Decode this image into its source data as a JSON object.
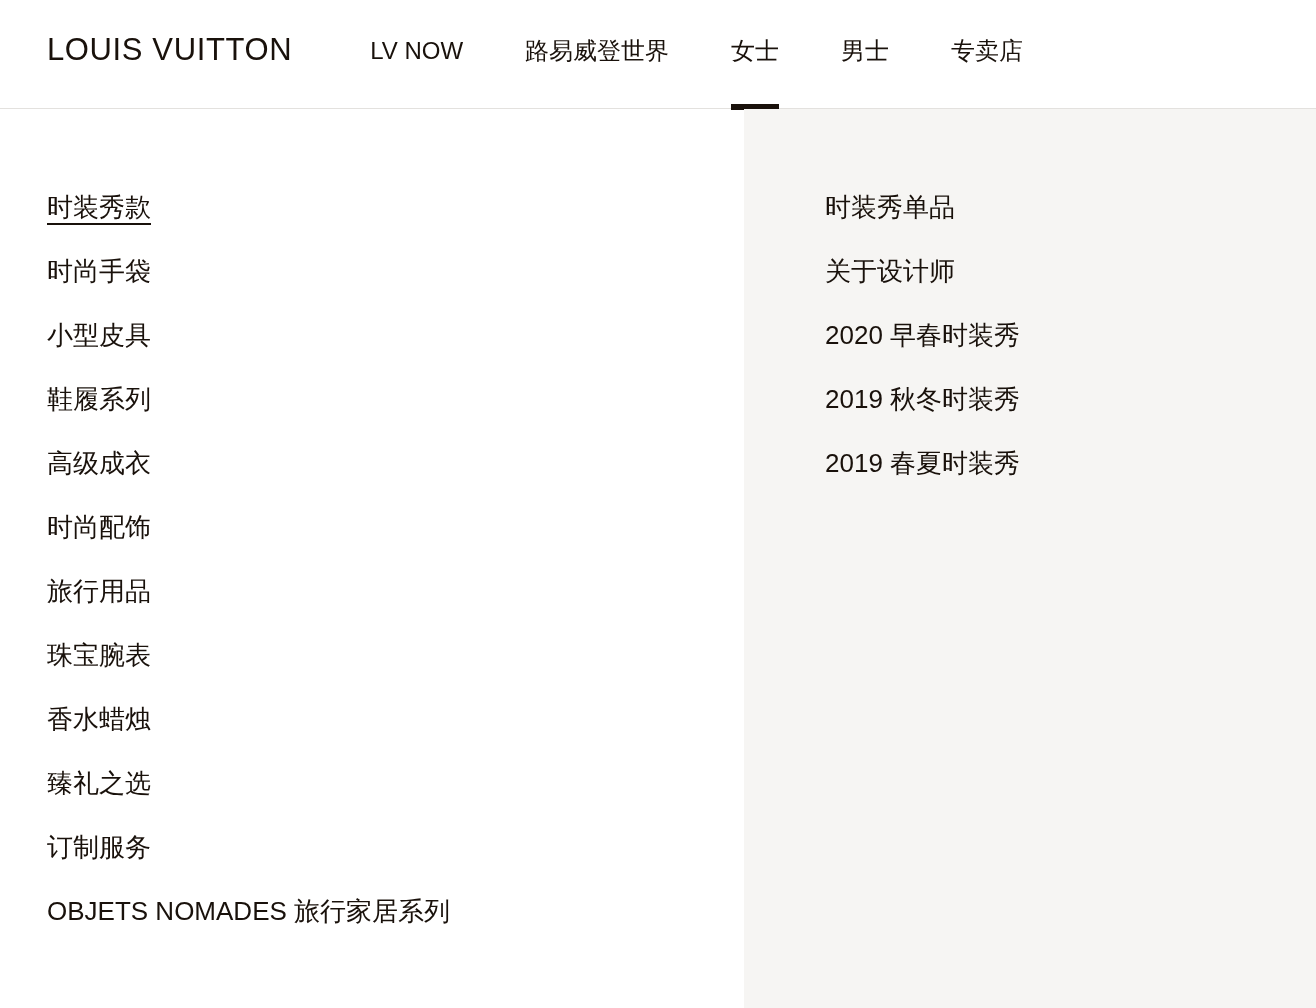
{
  "header": {
    "logo": "LOUIS VUITTON",
    "tabs": [
      {
        "label": "LV NOW",
        "selected": false
      },
      {
        "label": "路易威登世界",
        "selected": false
      },
      {
        "label": "女士",
        "selected": true
      },
      {
        "label": "男士",
        "selected": false
      },
      {
        "label": "专卖店",
        "selected": false
      }
    ]
  },
  "menu": {
    "primary_items": [
      {
        "label": "时装秀款",
        "selected": true
      },
      {
        "label": "时尚手袋",
        "selected": false
      },
      {
        "label": "小型皮具",
        "selected": false
      },
      {
        "label": "鞋履系列",
        "selected": false
      },
      {
        "label": "高级成衣",
        "selected": false
      },
      {
        "label": "时尚配饰",
        "selected": false
      },
      {
        "label": "旅行用品",
        "selected": false
      },
      {
        "label": "珠宝腕表",
        "selected": false
      },
      {
        "label": "香水蜡烛",
        "selected": false
      },
      {
        "label": "臻礼之选",
        "selected": false
      },
      {
        "label": "订制服务",
        "selected": false
      },
      {
        "label": "OBJETS NOMADES 旅行家居系列",
        "selected": false
      }
    ],
    "secondary_items": [
      {
        "label": "时装秀单品",
        "selected": false
      },
      {
        "label": "关于设计师",
        "selected": false
      },
      {
        "label": "2020 早春时装秀",
        "selected": false
      },
      {
        "label": "2019 秋冬时装秀",
        "selected": false
      },
      {
        "label": "2019 春夏时装秀",
        "selected": false
      }
    ]
  }
}
